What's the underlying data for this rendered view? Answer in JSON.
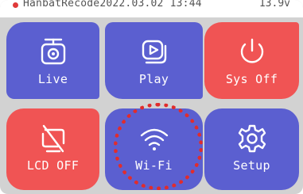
{
  "status_bar": {
    "text": "HanbatRecode2022.03.02  13:44",
    "voltage": "13.9v"
  },
  "tiles": [
    {
      "label": "Live",
      "icon": "camera-icon",
      "color": "#5b5fd0"
    },
    {
      "label": "Play",
      "icon": "play-icon",
      "color": "#5b5fd0"
    },
    {
      "label": "Sys Off",
      "icon": "power-icon",
      "color": "#f05454"
    },
    {
      "label": "LCD OFF",
      "icon": "screen-off-icon",
      "color": "#f05454"
    },
    {
      "label": "Wi-Fi",
      "icon": "wifi-icon",
      "color": "#5b5fd0"
    },
    {
      "label": "Setup",
      "icon": "gear-icon",
      "color": "#5b5fd0"
    }
  ],
  "selected_tile": "Wi-Fi"
}
